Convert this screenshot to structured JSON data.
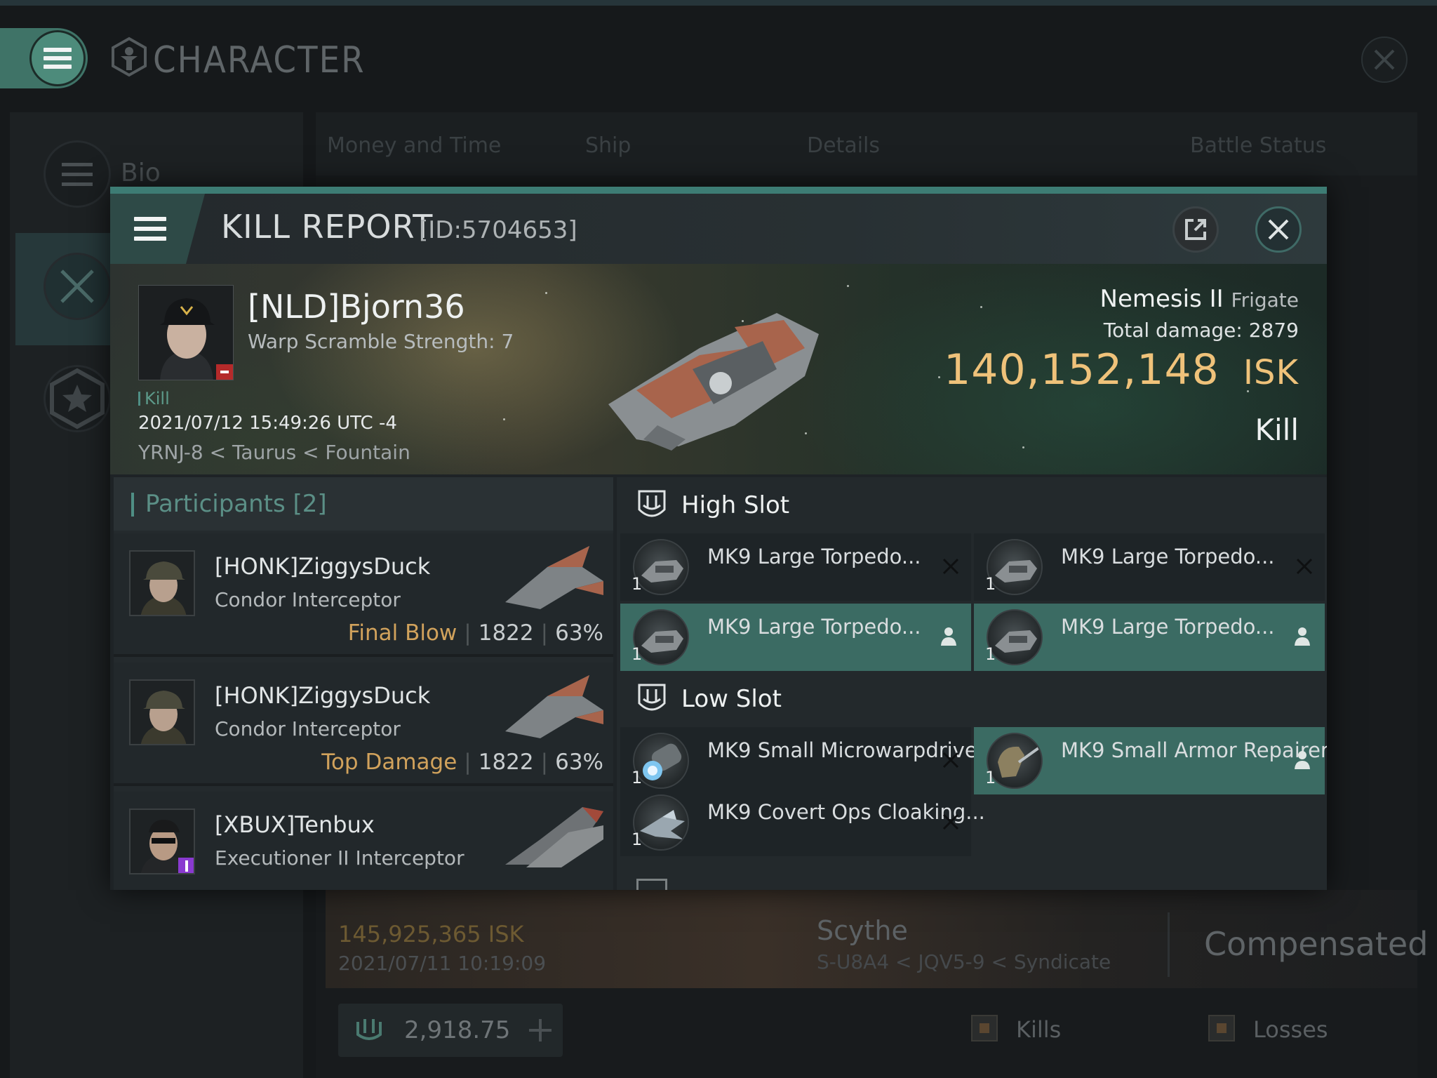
{
  "header": {
    "title": "CHARACTER"
  },
  "sidebar": {
    "bio_label": "Bio"
  },
  "background": {
    "tabs": [
      "Money and Time",
      "Ship",
      "Details",
      "Battle Status"
    ],
    "row": {
      "isk": "145,925,365 ISK",
      "date": "2021/07/11 10:19:09",
      "ship": "Scythe",
      "location": "S-U8A4 < JQV5-9 < Syndicate",
      "status": "Compensated"
    },
    "bottom": {
      "value": "2,918.75",
      "kills_label": "Kills",
      "losses_label": "Losses"
    }
  },
  "kill_report": {
    "title": "KILL REPORT",
    "id": "[ID:5704653]",
    "victim": {
      "name": "[NLD]Bjorn36",
      "subtitle": "Warp Scramble Strength: 7",
      "tag": "Kill",
      "datetime": "2021/07/12 15:49:26 UTC -4",
      "location": "YRNJ-8 < Taurus < Fountain",
      "ship": "Nemesis II",
      "ship_class": "Frigate",
      "total_damage_label": "Total damage:",
      "total_damage": "2879",
      "isk_value": "140,152,148",
      "isk_unit": "ISK",
      "result": "Kill"
    },
    "participants": {
      "title": "Participants",
      "count": "[2]",
      "rows": [
        {
          "name": "[HONK]ZiggysDuck",
          "ship": "Condor Interceptor",
          "label": "Final Blow",
          "damage": "1822",
          "percent": "63%"
        },
        {
          "name": "[HONK]ZiggysDuck",
          "ship": "Condor Interceptor",
          "label": "Top Damage",
          "damage": "1822",
          "percent": "63%"
        },
        {
          "name": "[XBUX]Tenbux",
          "ship": "Executioner II Interceptor",
          "label": "",
          "damage": "",
          "percent": ""
        }
      ]
    },
    "fitting": {
      "high_slot_title": "High Slot",
      "low_slot_title": "Low Slot",
      "high": [
        {
          "name": "MK9 Large Torpedo...",
          "qty": "1",
          "state": "destroyed"
        },
        {
          "name": "MK9 Large Torpedo...",
          "qty": "1",
          "state": "destroyed"
        },
        {
          "name": "MK9 Large Torpedo...",
          "qty": "1",
          "state": "dropped"
        },
        {
          "name": "MK9 Large Torpedo...",
          "qty": "1",
          "state": "dropped"
        }
      ],
      "low": [
        {
          "name": "MK9 Small Microwarpdrive",
          "qty": "1",
          "state": "destroyed"
        },
        {
          "name": "MK9 Small Armor Repairer",
          "qty": "1",
          "state": "dropped"
        },
        {
          "name": "MK9 Covert Ops Cloaking...",
          "qty": "1",
          "state": "destroyed"
        }
      ]
    }
  },
  "colors": {
    "accent": "#3d7c74",
    "isk": "#efc27a",
    "final_blow": "#d1a25c",
    "dropped_bg": "#3b6b63"
  }
}
